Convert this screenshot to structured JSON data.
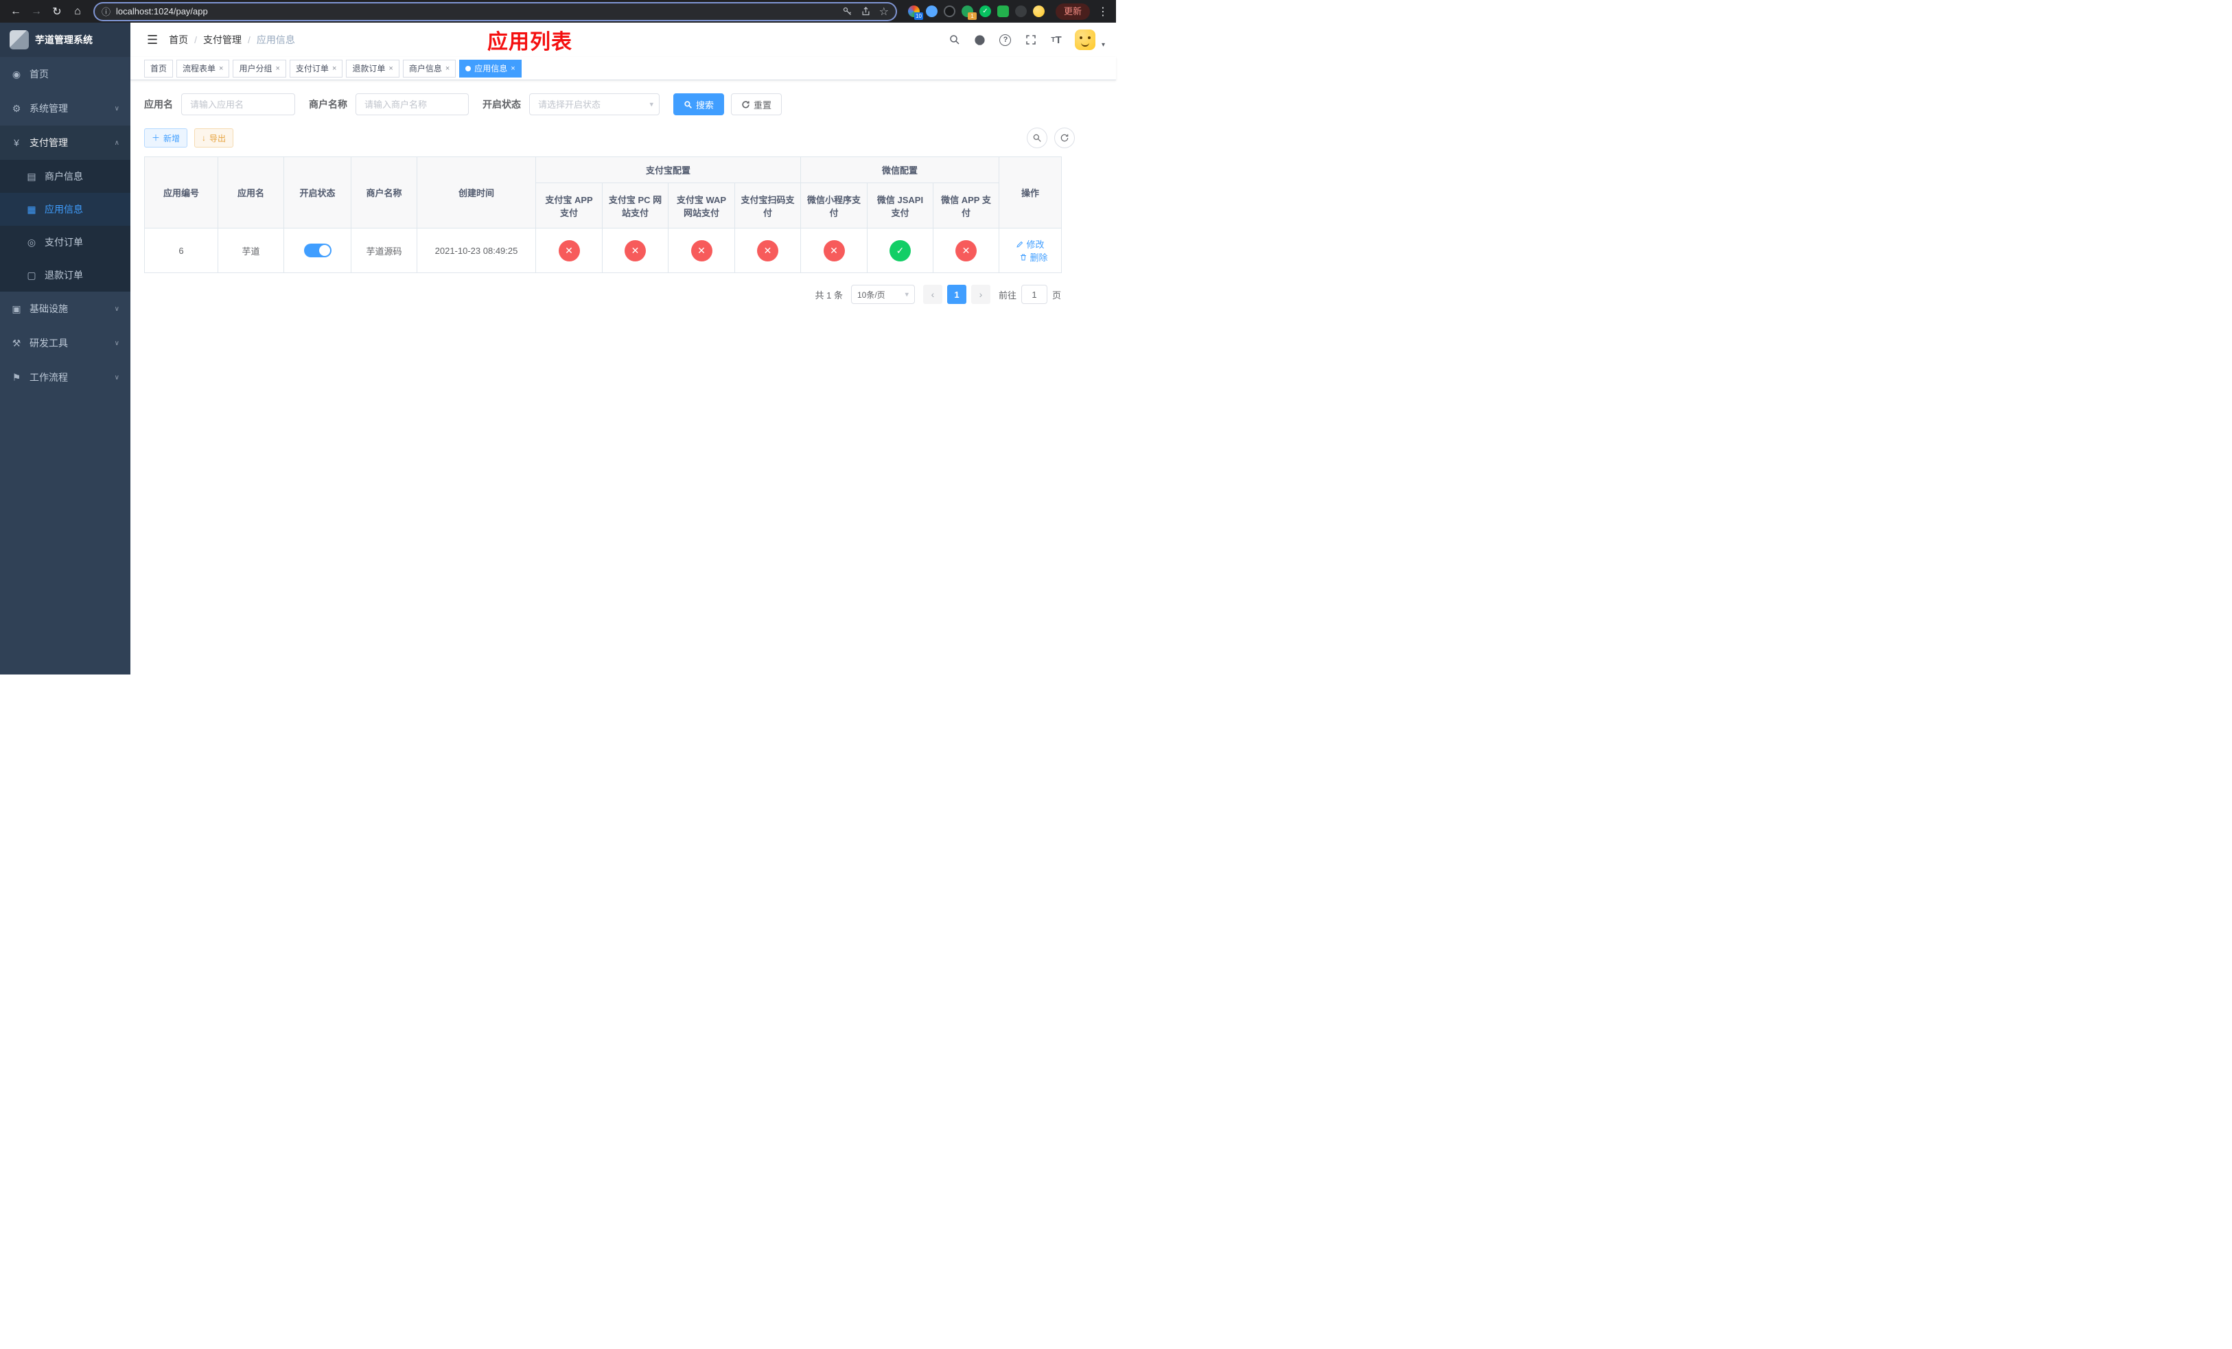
{
  "browser": {
    "url": "localhost:1024/pay/app",
    "update_button": "更新",
    "badges": {
      "pinned": "10",
      "green": "1"
    }
  },
  "sidebar": {
    "title": "芋道管理系统",
    "items": [
      {
        "label": "首页"
      },
      {
        "label": "系统管理"
      },
      {
        "label": "支付管理"
      },
      {
        "label": "基础设施"
      },
      {
        "label": "研发工具"
      },
      {
        "label": "工作流程"
      }
    ],
    "payment_children": [
      {
        "label": "商户信息"
      },
      {
        "label": "应用信息"
      },
      {
        "label": "支付订单"
      },
      {
        "label": "退款订单"
      }
    ]
  },
  "header": {
    "breadcrumb": [
      {
        "label": "首页"
      },
      {
        "label": "支付管理"
      },
      {
        "label": "应用信息"
      }
    ],
    "overlay_title": "应用列表"
  },
  "tabbar": {
    "tabs": [
      {
        "label": "首页"
      },
      {
        "label": "流程表单"
      },
      {
        "label": "用户分组"
      },
      {
        "label": "支付订单"
      },
      {
        "label": "退款订单"
      },
      {
        "label": "商户信息"
      },
      {
        "label": "应用信息"
      }
    ]
  },
  "filters": {
    "app_name_label": "应用名",
    "app_name_placeholder": "请输入应用名",
    "merchant_label": "商户名称",
    "merchant_placeholder": "请输入商户名称",
    "status_label": "开启状态",
    "status_placeholder": "请选择开启状态",
    "search_button": "搜索",
    "reset_button": "重置"
  },
  "toolbar": {
    "add_button": "新增",
    "export_button": "导出"
  },
  "table": {
    "groups": {
      "alipay": "支付宝配置",
      "wechat": "微信配置"
    },
    "columns": {
      "id": "应用编号",
      "name": "应用名",
      "status": "开启状态",
      "merchant": "商户名称",
      "created": "创建时间",
      "alipay_app": "支付宝 APP 支付",
      "alipay_pc": "支付宝 PC 网站支付",
      "alipay_wap": "支付宝 WAP 网站支付",
      "alipay_qr": "支付宝扫码支付",
      "wx_mini": "微信小程序支付",
      "wx_jsapi": "微信 JSAPI 支付",
      "wx_app": "微信 APP 支付",
      "actions": "操作"
    },
    "rows": [
      {
        "id": "6",
        "name": "芋道",
        "enabled": true,
        "merchant": "芋道源码",
        "created": "2021-10-23 08:49:25",
        "statuses": [
          false,
          false,
          false,
          false,
          false,
          true,
          false
        ],
        "edit": "修改",
        "delete": "删除"
      }
    ]
  },
  "pagination": {
    "total": "共 1 条",
    "page_size": "10条/页",
    "page": "1",
    "goto_label": "前往",
    "goto_value": "1",
    "unit": "页"
  }
}
